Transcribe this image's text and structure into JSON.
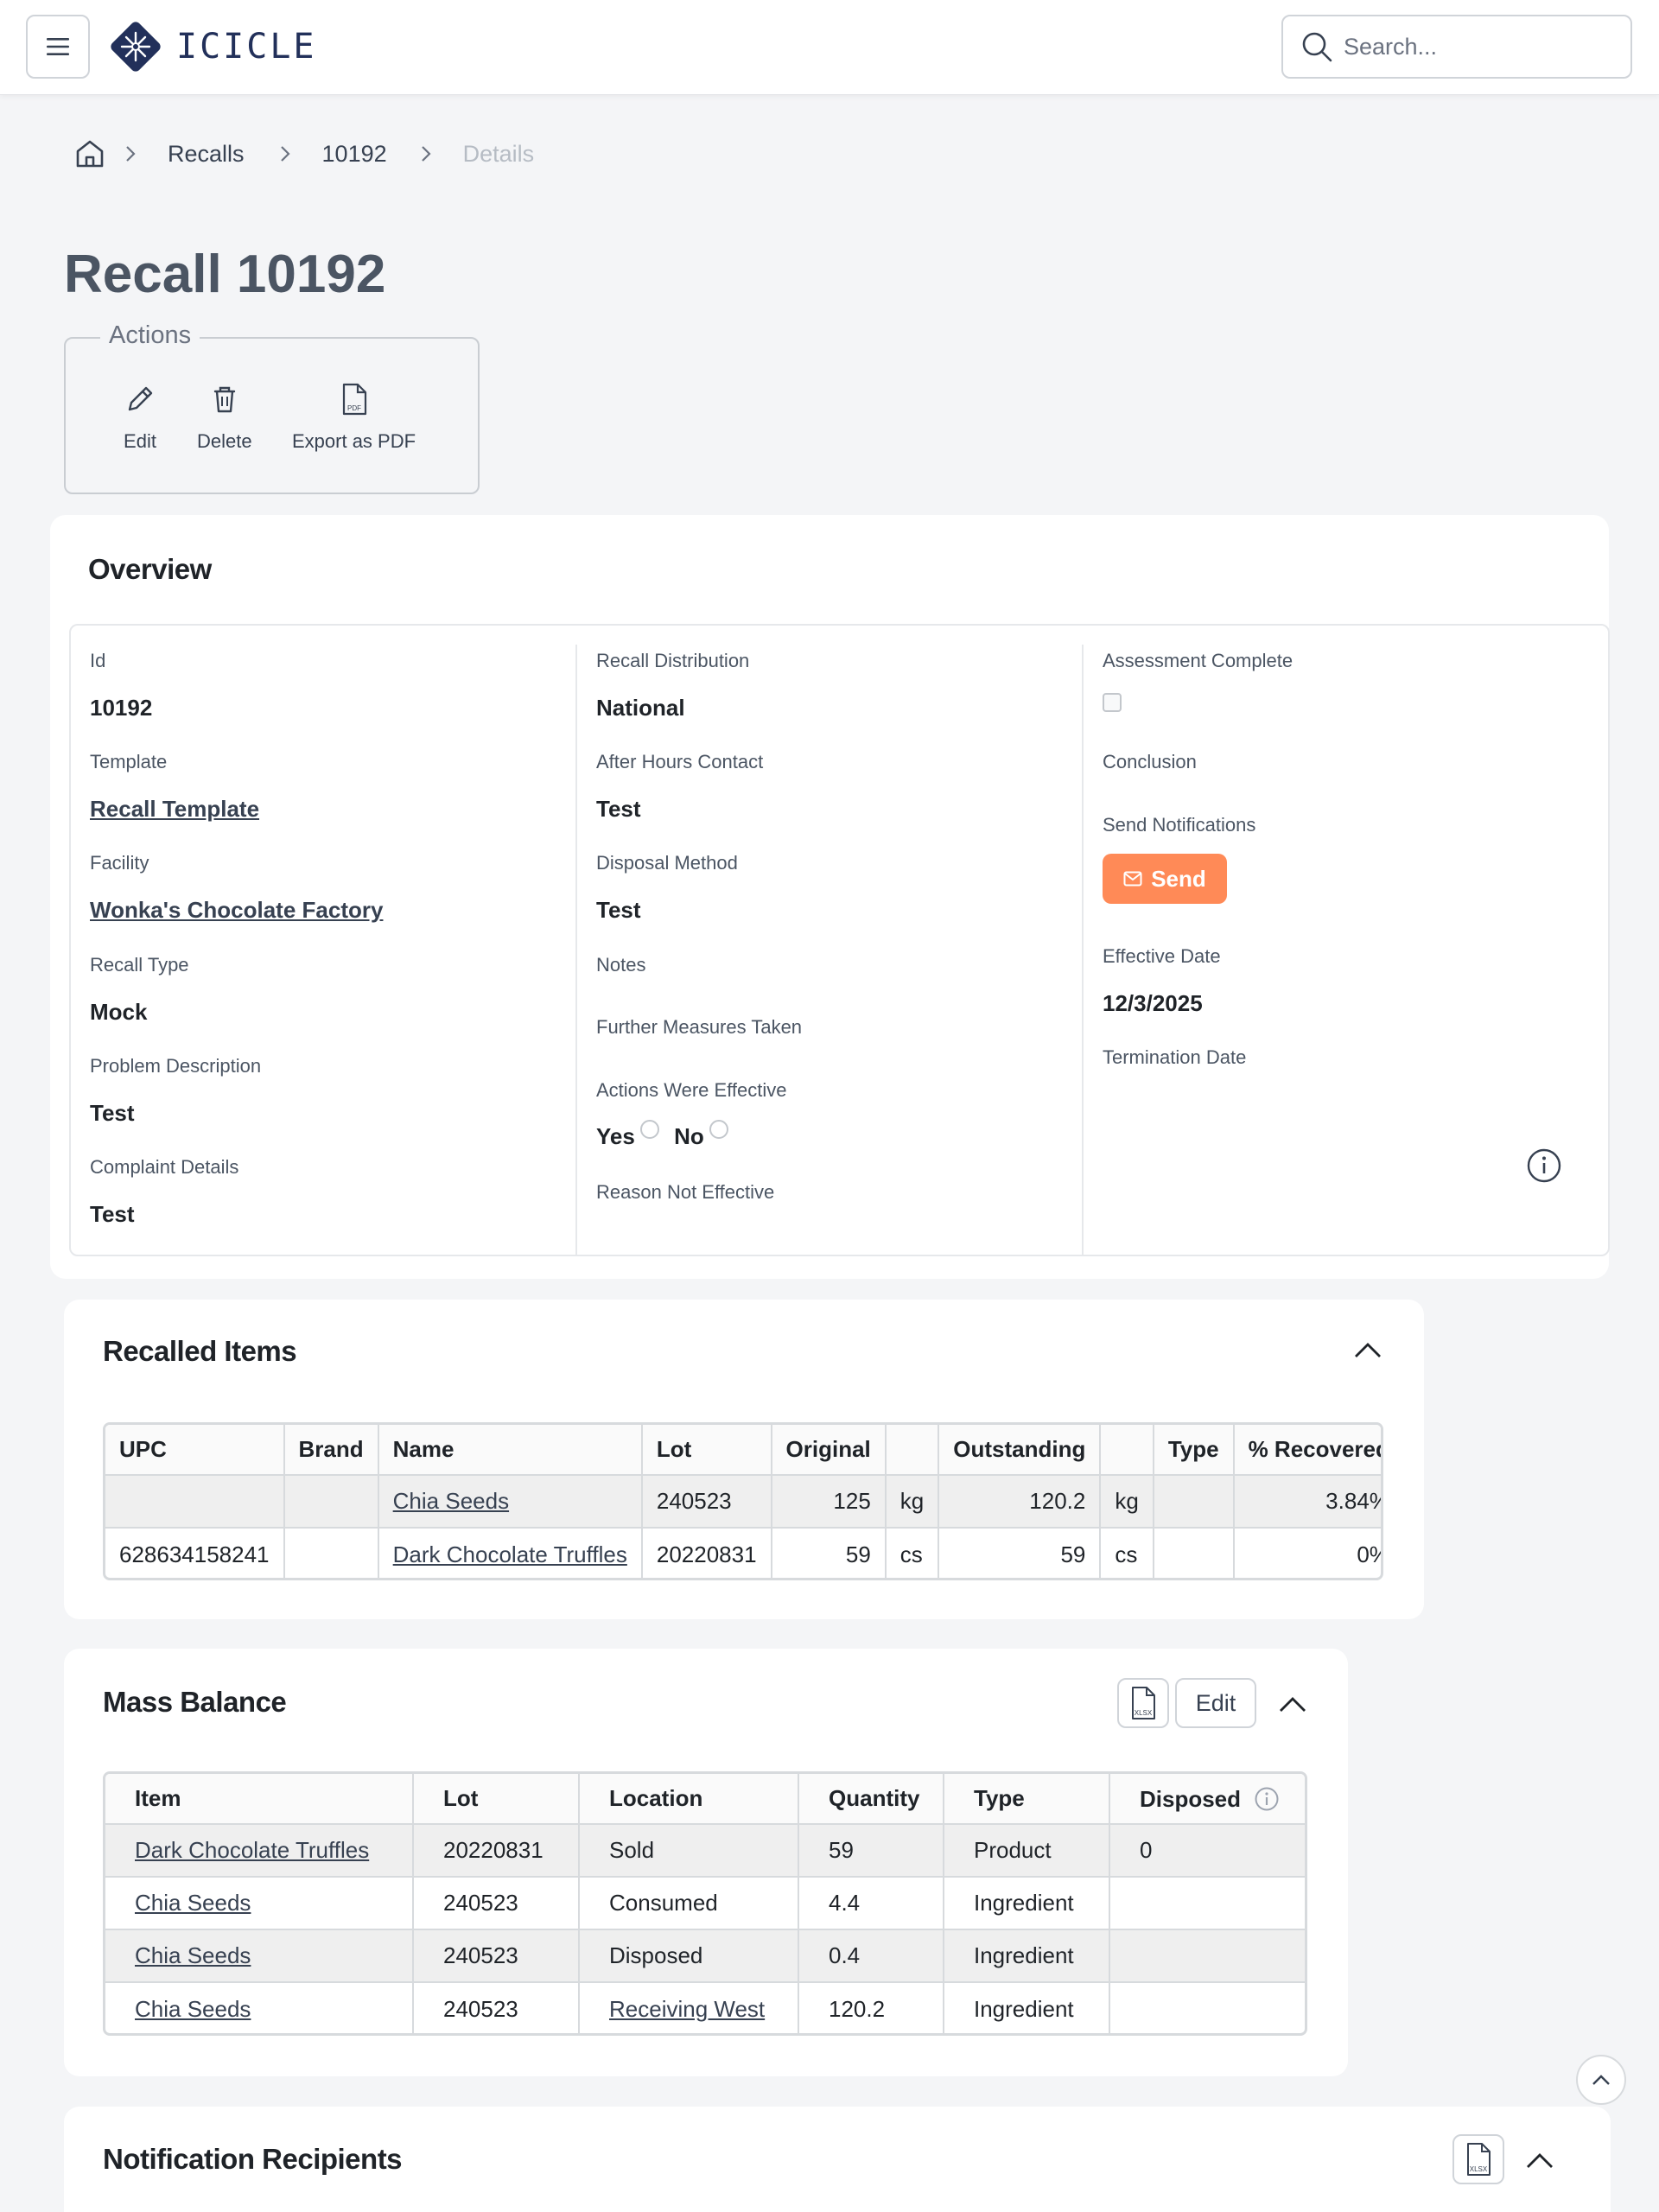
{
  "header": {
    "brand": "ICICLE",
    "search_placeholder": "Search..."
  },
  "breadcrumb": {
    "items": [
      "Recalls",
      "10192"
    ],
    "current": "Details"
  },
  "page": {
    "title": "Recall 10192"
  },
  "actions": {
    "legend": "Actions",
    "edit": "Edit",
    "delete": "Delete",
    "export": "Export as PDF"
  },
  "overview": {
    "title": "Overview",
    "col1": {
      "id_label": "Id",
      "id_value": "10192",
      "template_label": "Template",
      "template_value": "Recall Template",
      "facility_label": "Facility",
      "facility_value": "Wonka's Chocolate Factory",
      "recall_type_label": "Recall Type",
      "recall_type_value": "Mock",
      "problem_label": "Problem Description",
      "problem_value": "Test",
      "complaint_label": "Complaint Details",
      "complaint_value": "Test"
    },
    "col2": {
      "distribution_label": "Recall Distribution",
      "distribution_value": "National",
      "after_hours_label": "After Hours Contact",
      "after_hours_value": "Test",
      "disposal_label": "Disposal Method",
      "disposal_value": "Test",
      "notes_label": "Notes",
      "further_label": "Further Measures Taken",
      "effective_label": "Actions Were Effective",
      "yes": "Yes",
      "no": "No",
      "reason_label": "Reason Not Effective"
    },
    "col3": {
      "assessment_label": "Assessment Complete",
      "assessment_checked": false,
      "conclusion_label": "Conclusion",
      "send_label": "Send Notifications",
      "send_button": "Send",
      "effective_date_label": "Effective Date",
      "effective_date_value": "12/3/2025",
      "termination_label": "Termination Date"
    }
  },
  "recalled_items": {
    "title": "Recalled Items",
    "headers": [
      "UPC",
      "Brand",
      "Name",
      "Lot",
      "Original",
      "",
      "Outstanding",
      "",
      "Type",
      "% Recovered"
    ],
    "rows": [
      [
        "",
        "",
        "Chia Seeds",
        "240523",
        "125",
        "kg",
        "120.2",
        "kg",
        "",
        "3.84%"
      ],
      [
        "628634158241",
        "",
        "Dark Chocolate Truffles",
        "20220831",
        "59",
        "cs",
        "59",
        "cs",
        "",
        "0%"
      ]
    ]
  },
  "mass_balance": {
    "title": "Mass Balance",
    "edit_button": "Edit",
    "export_badge": "XLSX",
    "headers": [
      "Item",
      "Lot",
      "Location",
      "Quantity",
      "Type",
      "Disposed"
    ],
    "rows": [
      [
        "Dark Chocolate Truffles",
        "20220831",
        "Sold",
        "59",
        "Product",
        "0"
      ],
      [
        "Chia Seeds",
        "240523",
        "Consumed",
        "4.4",
        "Ingredient",
        ""
      ],
      [
        "Chia Seeds",
        "240523",
        "Disposed",
        "0.4",
        "Ingredient",
        ""
      ],
      [
        "Chia Seeds",
        "240523",
        "Receiving West",
        "120.2",
        "Ingredient",
        ""
      ]
    ]
  },
  "notification_recipients": {
    "title": "Notification Recipients",
    "export_badge": "XLSX"
  },
  "icons": {
    "pdf_badge": "PDF"
  },
  "colors": {
    "accent": "#ff8a57",
    "brand": "#22305a",
    "page_bg": "#f4f5f7"
  }
}
